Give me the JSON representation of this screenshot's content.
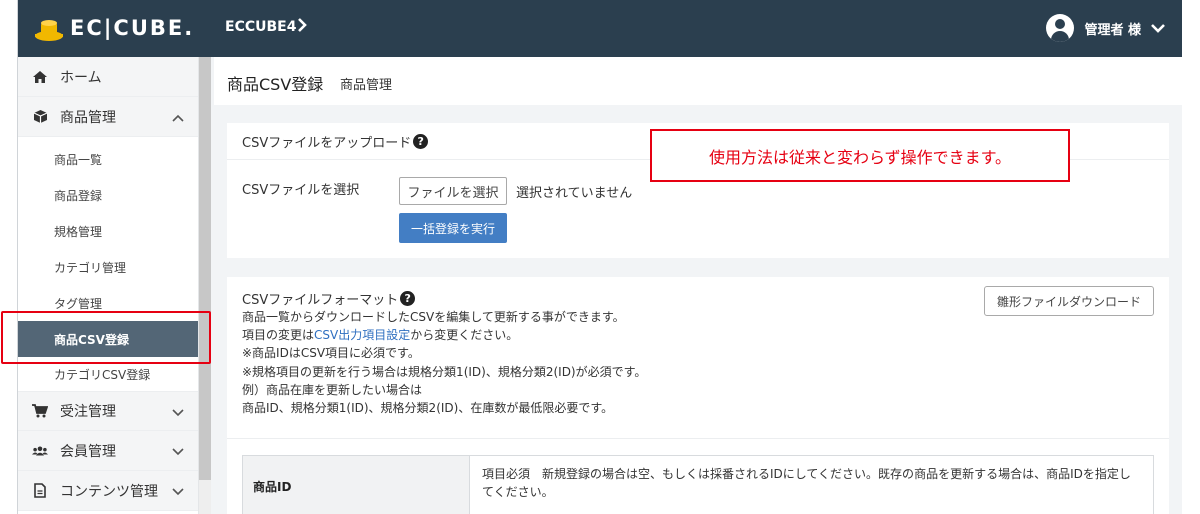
{
  "header": {
    "logo_text": "EC|CUBE.",
    "shop_name": "ECCUBE4",
    "user_name": "管理者 様"
  },
  "sidebar": {
    "items": [
      {
        "label": "ホーム",
        "icon": "home-icon"
      },
      {
        "label": "商品管理",
        "icon": "box-icon",
        "expanded": true
      },
      {
        "label": "受注管理",
        "icon": "cart-icon"
      },
      {
        "label": "会員管理",
        "icon": "users-icon"
      },
      {
        "label": "コンテンツ管理",
        "icon": "file-icon"
      }
    ],
    "sub_items": [
      {
        "label": "商品一覧"
      },
      {
        "label": "商品登録"
      },
      {
        "label": "規格管理"
      },
      {
        "label": "カテゴリ管理"
      },
      {
        "label": "タグ管理"
      },
      {
        "label": "商品CSV登録",
        "active": true
      },
      {
        "label": "カテゴリCSV登録"
      }
    ]
  },
  "page": {
    "title": "商品CSV登録",
    "subtitle": "商品管理"
  },
  "upload_card": {
    "header": "CSVファイルをアップロード",
    "select_label": "CSVファイルを選択",
    "file_button": "ファイルを選択",
    "file_status": "選択されていません",
    "submit_button": "一括登録を実行"
  },
  "format_card": {
    "header": "CSVファイルフォーマット",
    "template_button": "雛形ファイルダウンロード",
    "line1": "商品一覧からダウンロードしたCSVを編集して更新する事ができます。",
    "line2_pre": "項目の変更は",
    "line2_link": "CSV出力項目設定",
    "line2_post": "から変更ください。",
    "line3": "※商品IDはCSV項目に必須です。",
    "line4": "※規格項目の更新を行う場合は規格分類1(ID)、規格分類2(ID)が必須です。",
    "line5": "例）商品在庫を更新したい場合は",
    "line6": "商品ID、規格分類1(ID)、規格分類2(ID)、在庫数が最低限必要です。",
    "table": [
      {
        "key": "商品ID",
        "value": "項目必須　新規登録の場合は空、もしくは採番されるIDにしてください。既存の商品を更新する場合は、商品IDを指定してください。"
      }
    ]
  },
  "callout": {
    "text": "使用方法は従来と変わらず操作できます。"
  },
  "colors": {
    "header_bg": "#2b3f4f",
    "active_bg": "#536676",
    "primary_button": "#437ec4",
    "callout_red": "#e60012",
    "logo_gold": "#f1b800"
  }
}
